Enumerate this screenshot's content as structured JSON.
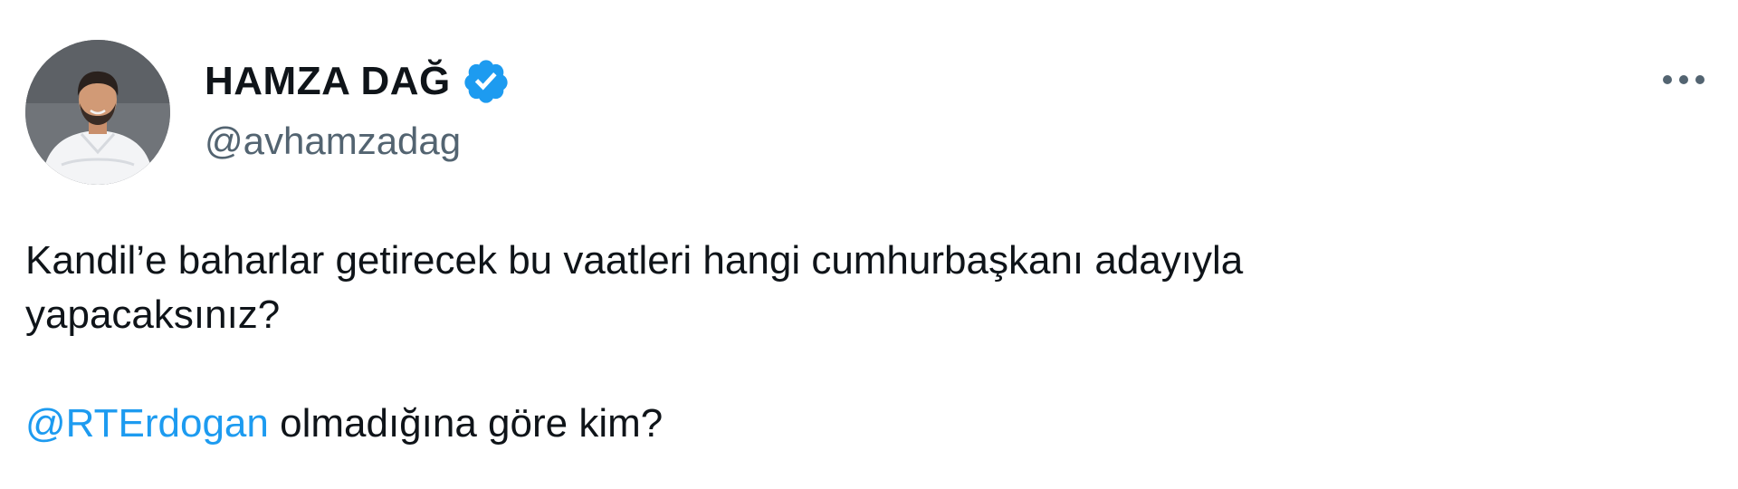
{
  "author": {
    "display_name": "HAMZA DAĞ",
    "handle": "@avhamzadag",
    "verified": true,
    "avatar_icon": "profile-photo"
  },
  "menu": {
    "icon": "more-horizontal-icon"
  },
  "tweet": {
    "line1": "Kandil’e baharlar getirecek bu vaatleri hangi cumhurbaşkanı adayıyla",
    "line2": "yapacaksınız?",
    "mention": "@RTErdogan",
    "line3_rest": " olmadığına göre kim?"
  },
  "colors": {
    "text": "#0f1419",
    "secondary_text": "#536471",
    "link": "#1d9bf0",
    "verified_badge": "#1d9bf0",
    "background": "#ffffff"
  }
}
